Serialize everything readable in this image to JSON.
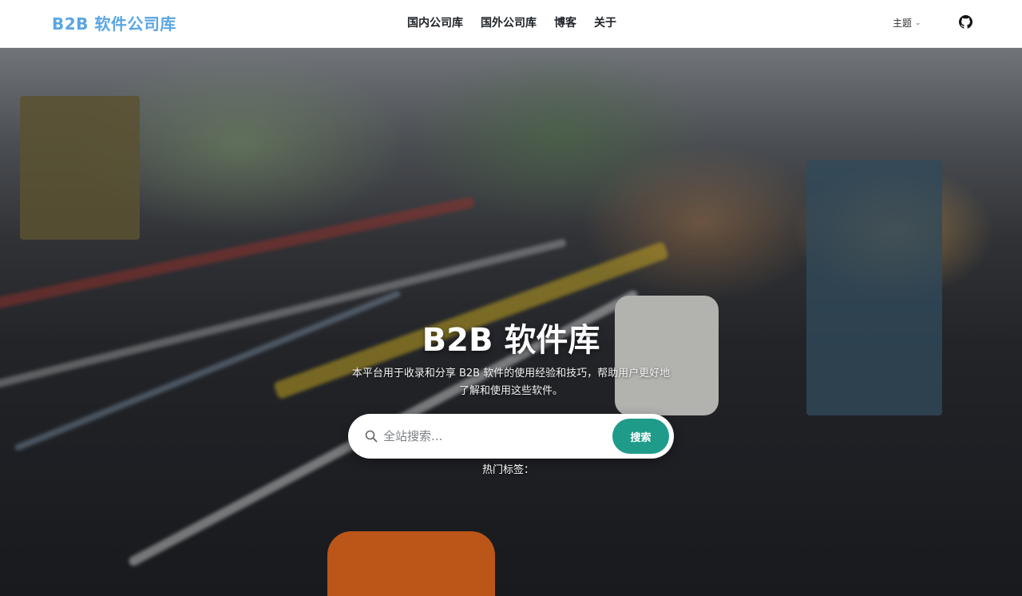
{
  "header": {
    "brand": "B2B 软件公司库",
    "nav": [
      "国内公司库",
      "国外公司库",
      "博客",
      "关于"
    ],
    "theme_label": "主题",
    "github_icon": "github-icon"
  },
  "hero": {
    "title": "B2B 软件库",
    "description": "本平台用于收录和分享 B2B 软件的使用经验和技巧，帮助用户更好地了解和使用这些软件。",
    "search": {
      "placeholder": "全站搜索...",
      "button_label": "搜索"
    },
    "hot_tags_label": "热门标签："
  },
  "colors": {
    "brand": "#5aa6e4",
    "search_button": "#1f9b8a"
  }
}
